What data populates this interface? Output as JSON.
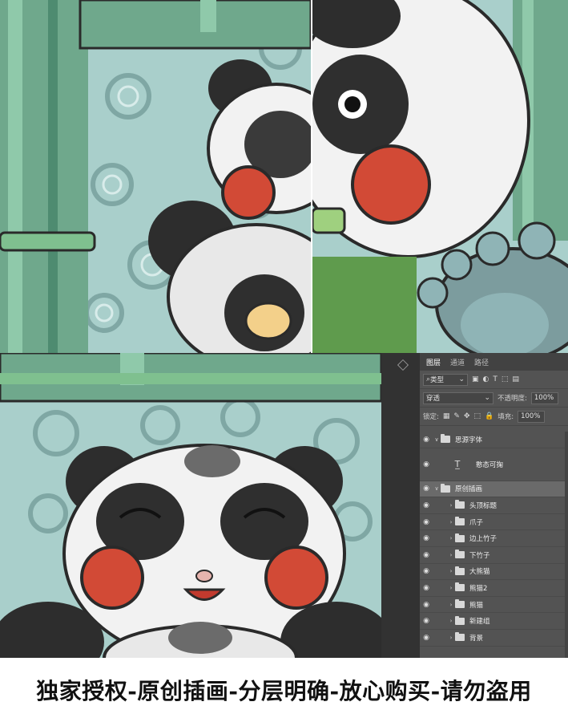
{
  "layers_panel": {
    "tabs": [
      "图层",
      "通道",
      "路径"
    ],
    "filter_label": "类型",
    "blend_mode": "穿透",
    "opacity_label": "不透明度:",
    "opacity_value": "100%",
    "lock_label": "锁定:",
    "fill_label": "填充:",
    "fill_value": "100%",
    "layers": [
      {
        "name": "思源字体",
        "kind": "group",
        "expanded": true,
        "indent": 0
      },
      {
        "name": "憨态可掬",
        "kind": "text",
        "indent": 1
      },
      {
        "name": "原创插画",
        "kind": "group",
        "expanded": true,
        "indent": 0,
        "selected": true
      },
      {
        "name": "头顶标题",
        "kind": "group",
        "indent": 1
      },
      {
        "name": "爪子",
        "kind": "group",
        "indent": 1
      },
      {
        "name": "边上竹子",
        "kind": "group",
        "indent": 1
      },
      {
        "name": "下竹子",
        "kind": "group",
        "indent": 1
      },
      {
        "name": "大熊猫",
        "kind": "group",
        "indent": 1
      },
      {
        "name": "熊猫2",
        "kind": "group",
        "indent": 1
      },
      {
        "name": "熊猫",
        "kind": "group",
        "indent": 1
      },
      {
        "name": "新建组",
        "kind": "group",
        "indent": 1
      },
      {
        "name": "背景",
        "kind": "group",
        "indent": 1
      }
    ]
  },
  "banner": {
    "text": "独家授权-原创插画-分层明确-放心购买-请勿盗用"
  },
  "colors": {
    "bamboo": "#7fb59a",
    "cloud_bg": "#a9cfcb",
    "outline": "#2a2a2a",
    "cheek": "#d24a36",
    "ps_panel": "#535353"
  }
}
